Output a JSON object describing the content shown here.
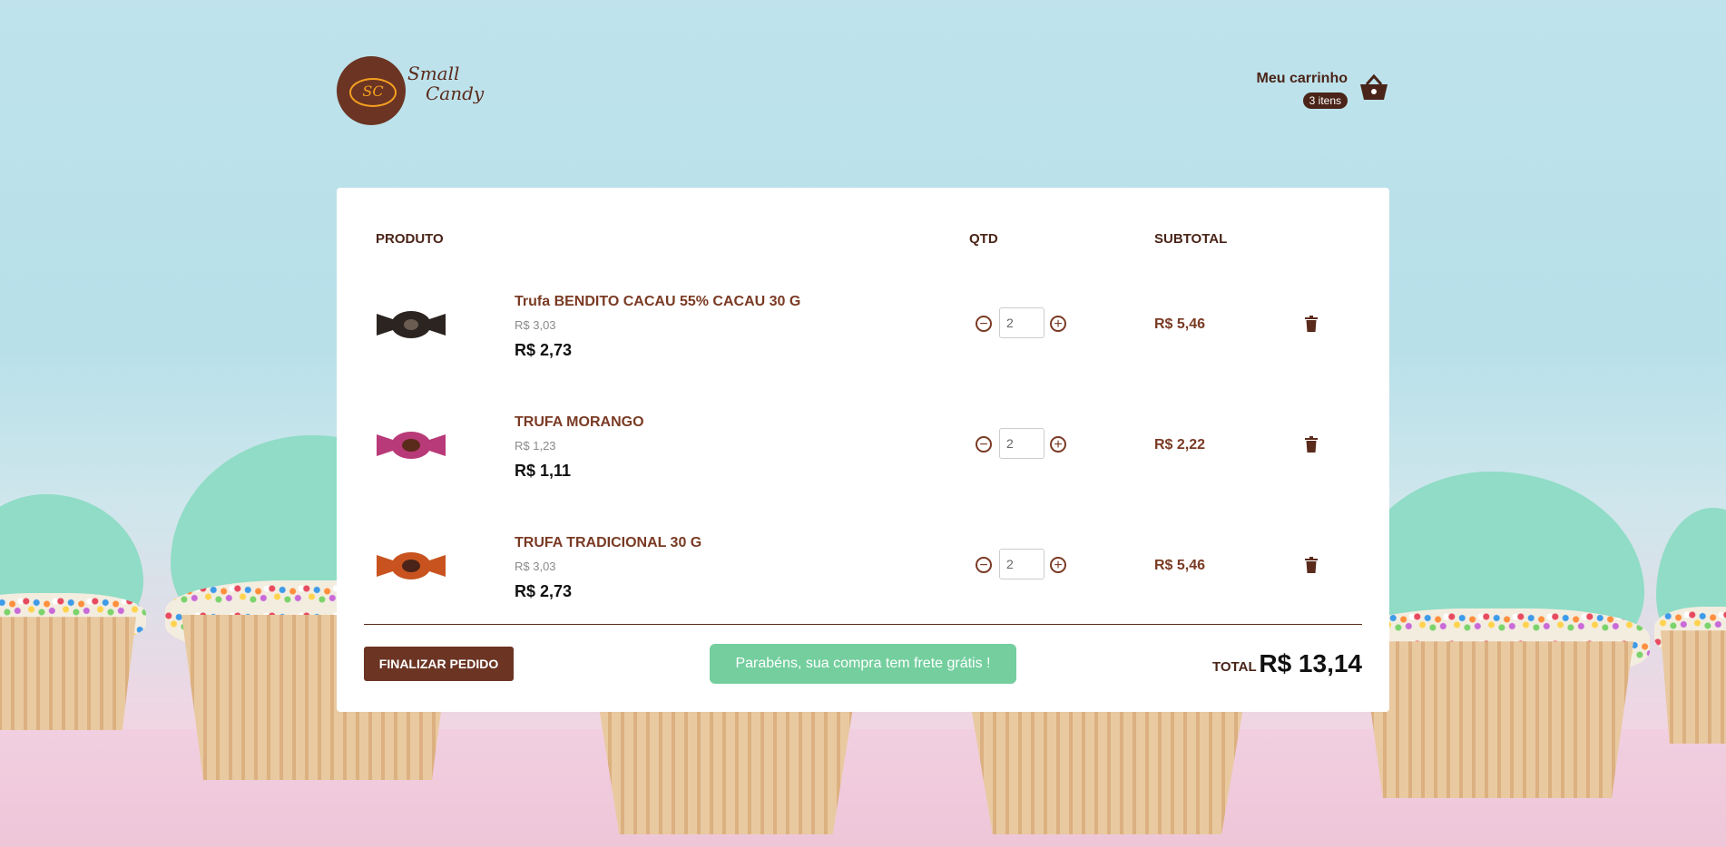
{
  "brand": {
    "name_line1": "Small",
    "name_line2": "Candy",
    "mark": "SC"
  },
  "cart": {
    "label": "Meu carrinho",
    "badge": "3 itens",
    "icon": "basket-icon"
  },
  "table": {
    "headers": {
      "product": "PRODUTO",
      "qty": "QTD",
      "subtotal": "SUBTOTAL"
    },
    "items": [
      {
        "name": "Trufa BENDITO CACAU 55% CACAU 30 G",
        "original_price": "R$ 3,03",
        "price": "R$ 2,73",
        "qty": "2",
        "subtotal": "R$ 5,46",
        "wrapper_color": "#2b2420"
      },
      {
        "name": "TRUFA MORANGO",
        "original_price": "R$ 1,23",
        "price": "R$ 1,11",
        "qty": "2",
        "subtotal": "R$ 2,22",
        "wrapper_color": "#b93a78"
      },
      {
        "name": "TRUFA TRADICIONAL 30 G",
        "original_price": "R$ 3,03",
        "price": "R$ 2,73",
        "qty": "2",
        "subtotal": "R$ 5,46",
        "wrapper_color": "#c8531f"
      }
    ]
  },
  "footer": {
    "finalize_label": "FINALIZAR PEDIDO",
    "shipping_message": "Parabéns, sua compra tem frete grátis !",
    "total_label": "TOTAL",
    "total_value": "R$ 13,14"
  },
  "colors": {
    "brand": "#6b3423",
    "success": "#74ce9e"
  }
}
